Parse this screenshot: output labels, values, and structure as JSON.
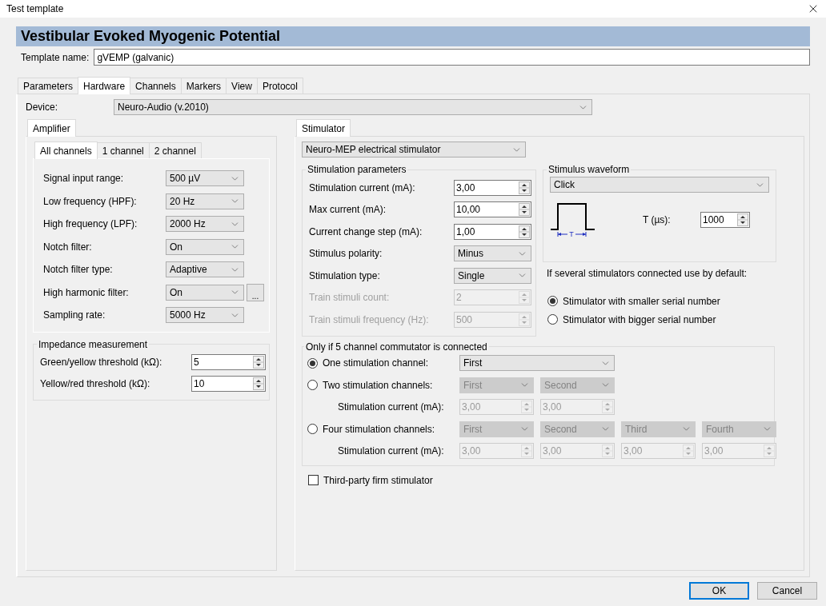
{
  "window": {
    "title": "Test template"
  },
  "header": {
    "title": "Vestibular Evoked Myogenic Potential"
  },
  "template_name": {
    "label": "Template name:",
    "value": "gVEMP (galvanic)"
  },
  "tabs": [
    {
      "label": "Parameters",
      "selected": false
    },
    {
      "label": "Hardware",
      "selected": true
    },
    {
      "label": "Channels",
      "selected": false
    },
    {
      "label": "Markers",
      "selected": false
    },
    {
      "label": "View",
      "selected": false
    },
    {
      "label": "Protocol",
      "selected": false
    }
  ],
  "device": {
    "label": "Device:",
    "value": "Neuro-Audio (v.2010)"
  },
  "amplifier": {
    "tab": "Amplifier",
    "channel_tabs": [
      {
        "label": "All channels",
        "selected": true
      },
      {
        "label": "1 channel",
        "selected": false
      },
      {
        "label": "2 channel",
        "selected": false
      }
    ],
    "settings": [
      {
        "label": "Signal input range:",
        "value": "500 µV"
      },
      {
        "label": "Low frequency (HPF):",
        "value": "20 Hz"
      },
      {
        "label": "High frequency (LPF):",
        "value": "2000 Hz"
      },
      {
        "label": "Notch filter:",
        "value": "On"
      },
      {
        "label": "Notch filter type:",
        "value": "Adaptive"
      },
      {
        "label": "High harmonic filter:",
        "value": "On",
        "extra_button": "..."
      },
      {
        "label": "Sampling rate:",
        "value": "5000 Hz"
      }
    ],
    "impedance": {
      "title": "Impedance measurement",
      "rows": [
        {
          "label": "Green/yellow threshold (kΩ):",
          "value": "5"
        },
        {
          "label": "Yellow/red threshold (kΩ):",
          "value": "10"
        }
      ]
    }
  },
  "stimulator": {
    "tab": "Stimulator",
    "device": "Neuro-MEP electrical stimulator",
    "parameters": {
      "title": "Stimulation parameters",
      "rows": [
        {
          "kind": "spin",
          "label": "Stimulation current (mA):",
          "value": "3,00",
          "disabled": false
        },
        {
          "kind": "spin",
          "label": "Max current (mA):",
          "value": "10,00",
          "disabled": false
        },
        {
          "kind": "spin",
          "label": "Current change step (mA):",
          "value": "1,00",
          "disabled": false
        },
        {
          "kind": "select",
          "label": "Stimulus polarity:",
          "value": "Minus",
          "disabled": false
        },
        {
          "kind": "select",
          "label": "Stimulation type:",
          "value": "Single",
          "disabled": false
        },
        {
          "kind": "spin",
          "label": "Train stimuli count:",
          "value": "2",
          "disabled": true
        },
        {
          "kind": "spin",
          "label": "Train stimuli frequency (Hz):",
          "value": "500",
          "disabled": true
        }
      ]
    },
    "waveform": {
      "title": "Stimulus waveform",
      "value": "Click",
      "pulse_label": "T",
      "t_label": "T (µs):",
      "t_value": "1000"
    },
    "default_note": "If several stimulators connected use by default:",
    "default_options": [
      {
        "label": "Stimulator with smaller serial number",
        "selected": true
      },
      {
        "label": "Stimulator with bigger serial number",
        "selected": false
      }
    ],
    "commutator": {
      "title": "Only if 5 channel commutator is connected",
      "rows": [
        {
          "kind": "radio",
          "label": "One stimulation channel:",
          "selected": true,
          "fields": [
            {
              "kind": "select",
              "value": "First",
              "disabled": false
            }
          ]
        },
        {
          "kind": "radio",
          "label": "Two stimulation channels:",
          "selected": false,
          "fields": [
            {
              "kind": "select",
              "value": "First",
              "disabled": true
            },
            {
              "kind": "select",
              "value": "Second",
              "disabled": true
            }
          ]
        },
        {
          "kind": "current",
          "label": "Stimulation current (mA):",
          "fields": [
            {
              "kind": "spin",
              "value": "3,00",
              "disabled": true
            },
            {
              "kind": "spin",
              "value": "3,00",
              "disabled": true
            }
          ]
        },
        {
          "kind": "radio",
          "label": "Four stimulation channels:",
          "selected": false,
          "fields": [
            {
              "kind": "select",
              "value": "First",
              "disabled": true
            },
            {
              "kind": "select",
              "value": "Second",
              "disabled": true
            },
            {
              "kind": "select",
              "value": "Third",
              "disabled": true
            },
            {
              "kind": "select",
              "value": "Fourth",
              "disabled": true
            }
          ]
        },
        {
          "kind": "current",
          "label": "Stimulation current (mA):",
          "fields": [
            {
              "kind": "spin",
              "value": "3,00",
              "disabled": true
            },
            {
              "kind": "spin",
              "value": "3,00",
              "disabled": true
            },
            {
              "kind": "spin",
              "value": "3,00",
              "disabled": true
            },
            {
              "kind": "spin",
              "value": "3,00",
              "disabled": true
            }
          ]
        }
      ]
    },
    "third_party": {
      "label": "Third-party firm stimulator",
      "checked": false
    }
  },
  "buttons": [
    {
      "label": "OK",
      "default": true
    },
    {
      "label": "Cancel",
      "default": false
    }
  ]
}
